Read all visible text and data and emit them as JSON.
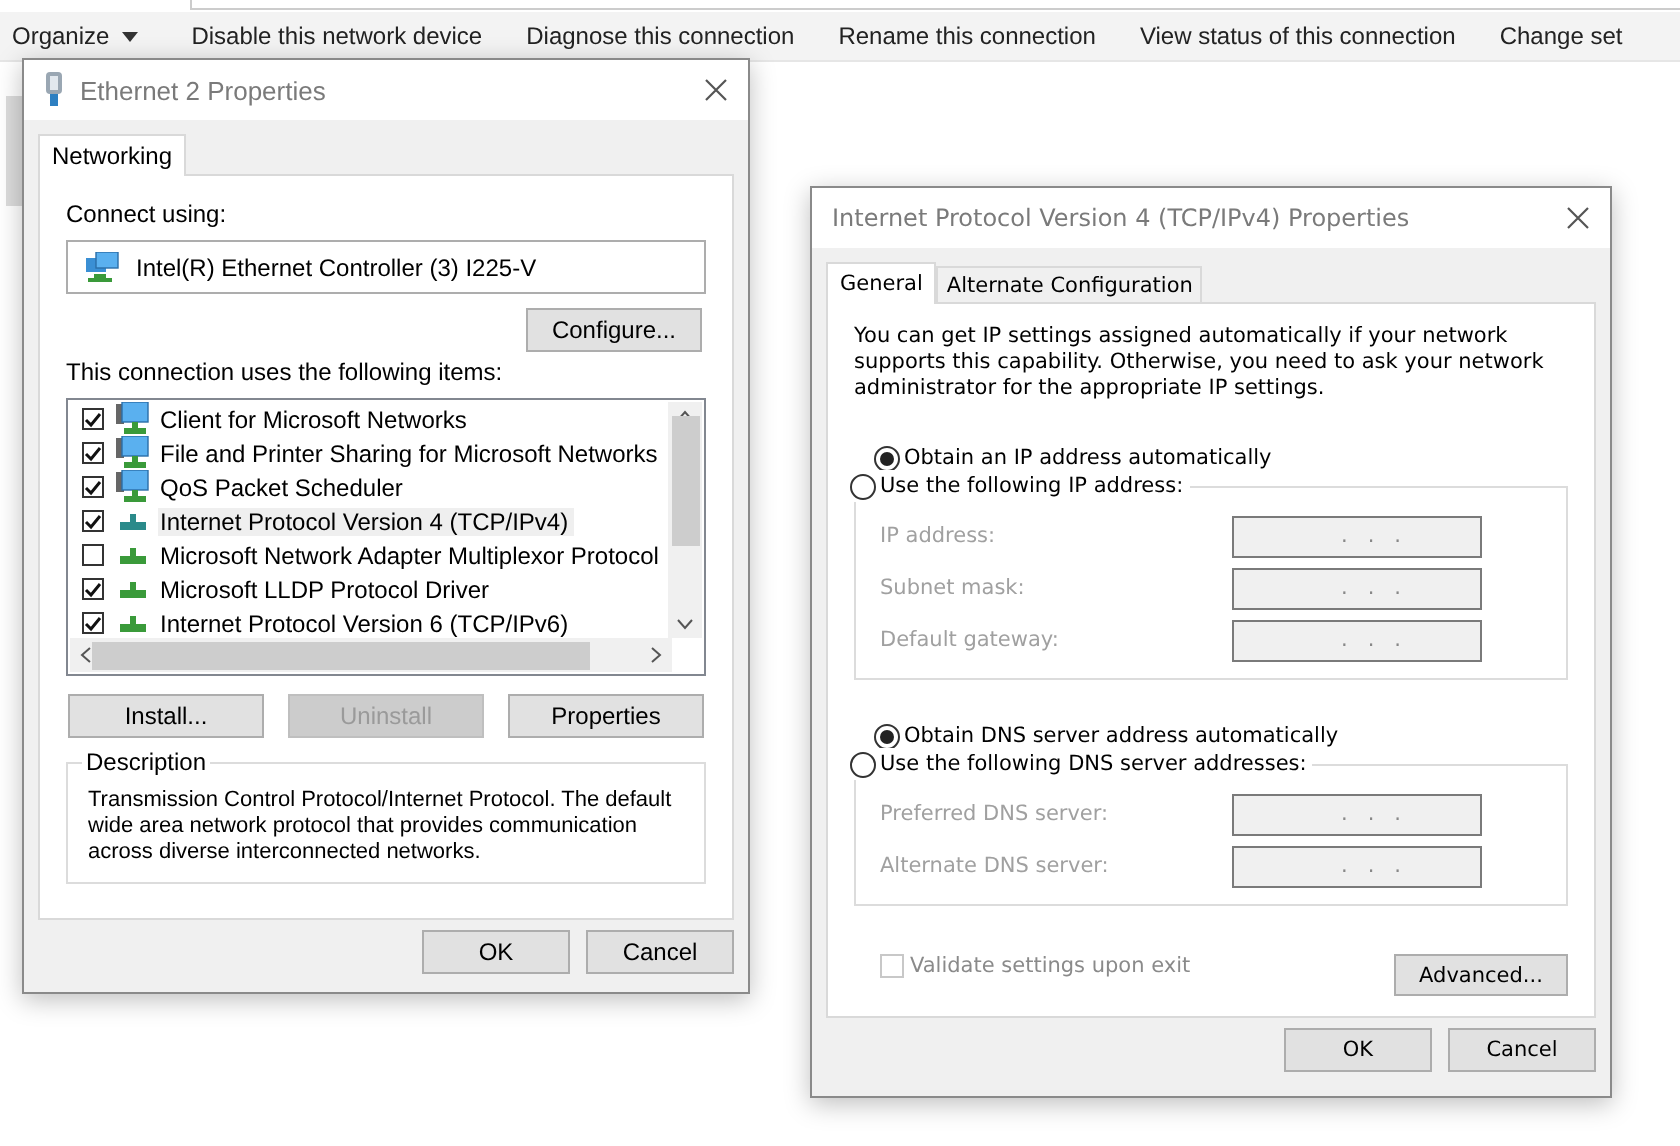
{
  "explorer": {
    "toolbar": [
      {
        "label": "Organize",
        "kind": "menu"
      },
      {
        "label": "Disable this network device",
        "kind": "action"
      },
      {
        "label": "Diagnose this connection",
        "kind": "action"
      },
      {
        "label": "Rename this connection",
        "kind": "action"
      },
      {
        "label": "View status of this connection",
        "kind": "action"
      },
      {
        "label": "Change set",
        "kind": "action"
      }
    ]
  },
  "ethernet_dialog": {
    "title": "Ethernet 2 Properties",
    "tabs": [
      {
        "label": "Networking",
        "selected": true
      }
    ],
    "connect_using_label": "Connect using:",
    "adapter": "Intel(R) Ethernet Controller (3) I225-V",
    "configure_button": "Configure...",
    "items_label": "This connection uses the following items:",
    "items": [
      {
        "label": "Client for Microsoft Networks",
        "kind": "service",
        "checked": true,
        "selected": false
      },
      {
        "label": "File and Printer Sharing for Microsoft Networks",
        "kind": "service",
        "checked": true,
        "selected": false
      },
      {
        "label": "QoS Packet Scheduler",
        "kind": "service",
        "checked": true,
        "selected": false
      },
      {
        "label": "Internet Protocol Version 4 (TCP/IPv4)",
        "kind": "protocol",
        "checked": true,
        "selected": true
      },
      {
        "label": "Microsoft Network Adapter Multiplexor Protocol",
        "kind": "protocol",
        "checked": false,
        "selected": false
      },
      {
        "label": "Microsoft LLDP Protocol Driver",
        "kind": "protocol",
        "checked": true,
        "selected": false
      },
      {
        "label": "Internet Protocol Version 6 (TCP/IPv6)",
        "kind": "protocol",
        "checked": true,
        "selected": false
      }
    ],
    "item_buttons": [
      {
        "label": "Install...",
        "disabled": false
      },
      {
        "label": "Uninstall",
        "disabled": true
      },
      {
        "label": "Properties",
        "disabled": false
      }
    ],
    "description_title": "Description",
    "description": "Transmission Control Protocol/Internet Protocol. The default wide area network protocol that provides communication across diverse interconnected networks.",
    "buttons": [
      "OK",
      "Cancel"
    ]
  },
  "ipv4_dialog": {
    "title": "Internet Protocol Version 4 (TCP/IPv4) Properties",
    "tabs": [
      {
        "label": "General",
        "selected": true
      },
      {
        "label": "Alternate Configuration",
        "selected": false
      }
    ],
    "intro": "You can get IP settings assigned automatically if your network supports this capability. Otherwise, you need to ask your network administrator for the appropriate IP settings.",
    "ip_section": {
      "auto_radio": {
        "label": "Obtain an IP address automatically",
        "selected": true
      },
      "manual_radio": {
        "label": "Use the following IP address:",
        "selected": false
      },
      "fields": [
        {
          "label": "IP address:",
          "value": ".   .   .",
          "disabled": true
        },
        {
          "label": "Subnet mask:",
          "value": ".   .   .",
          "disabled": true
        },
        {
          "label": "Default gateway:",
          "value": ".   .   .",
          "disabled": true
        }
      ]
    },
    "dns_section": {
      "auto_radio": {
        "label": "Obtain DNS server address automatically",
        "selected": true
      },
      "manual_radio": {
        "label": "Use the following DNS server addresses:",
        "selected": false
      },
      "fields": [
        {
          "label": "Preferred DNS server:",
          "value": ".   .   .",
          "disabled": true
        },
        {
          "label": "Alternate DNS server:",
          "value": ".   .   .",
          "disabled": true
        }
      ]
    },
    "validate": {
      "label": "Validate settings upon exit",
      "checked": false,
      "disabled": true
    },
    "advanced_button": "Advanced...",
    "buttons": [
      "OK",
      "Cancel"
    ]
  }
}
